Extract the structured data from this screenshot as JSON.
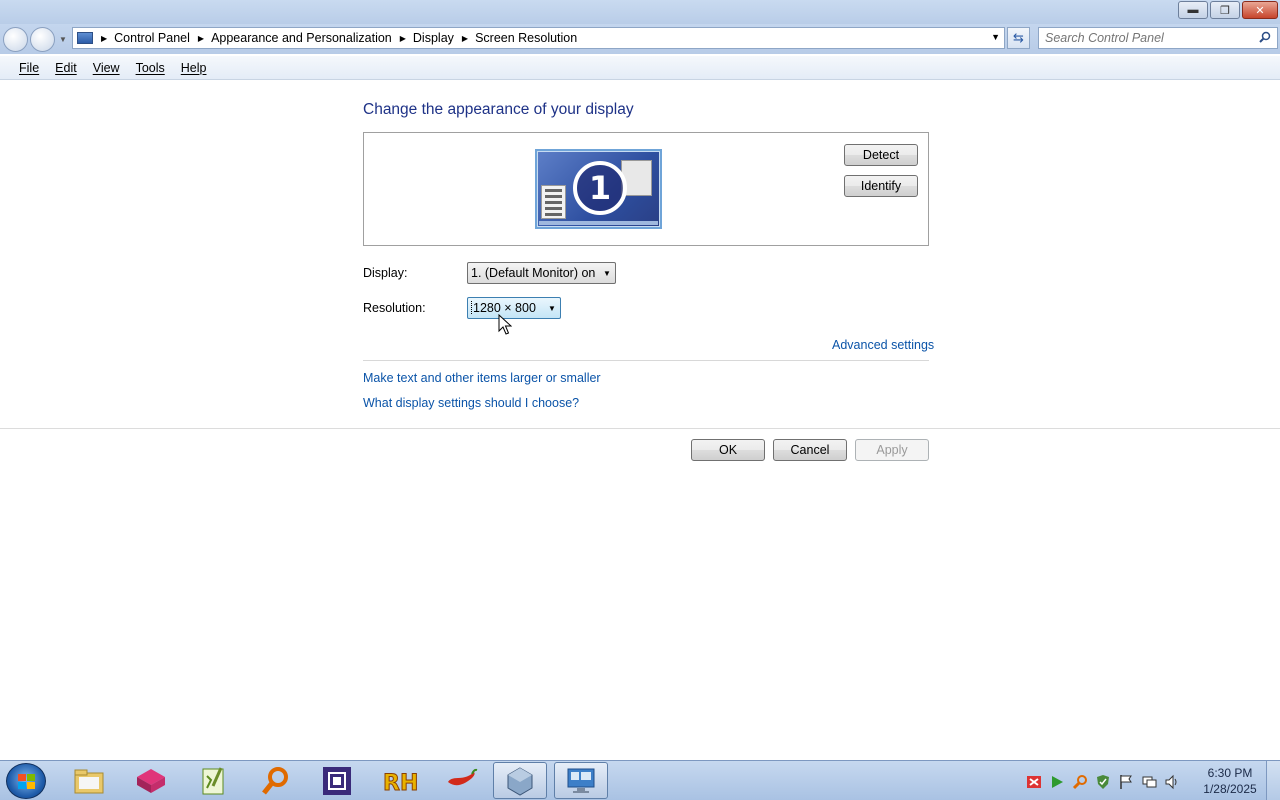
{
  "window": {
    "minimize_icon": "minimize-icon",
    "maximize_icon": "restore-icon",
    "close_icon": "close-icon"
  },
  "address": {
    "breadcrumbs": [
      "Control Panel",
      "Appearance and Personalization",
      "Display",
      "Screen Resolution"
    ],
    "search_placeholder": "Search Control Panel"
  },
  "menu": {
    "file": "File",
    "edit": "Edit",
    "view": "View",
    "tools": "Tools",
    "help": "Help"
  },
  "main": {
    "title": "Change the appearance of your display",
    "monitor_number": "1",
    "detect_label": "Detect",
    "identify_label": "Identify",
    "display_label": "Display:",
    "display_value": "1. (Default Monitor) on",
    "resolution_label": "Resolution:",
    "resolution_value": "1280 × 800",
    "advanced_link": "Advanced settings",
    "larger_link": "Make text and other items larger or smaller",
    "choose_link": "What display settings should I choose?",
    "ok_label": "OK",
    "cancel_label": "Cancel",
    "apply_label": "Apply"
  },
  "taskbar": {
    "items": [
      "windows-explorer-icon",
      "virtualbox-cube-icon",
      "notepad-plus-icon",
      "search-tool-icon",
      "cpu-z-icon",
      "resource-hacker-icon",
      "chili-icon",
      "virtualbox-icon",
      "display-settings-icon"
    ],
    "time": "6:30 PM",
    "date": "1/28/2025"
  },
  "colors": {
    "link": "#0b54a8",
    "title": "#1e3287",
    "taskbar": "#b7cde8"
  }
}
